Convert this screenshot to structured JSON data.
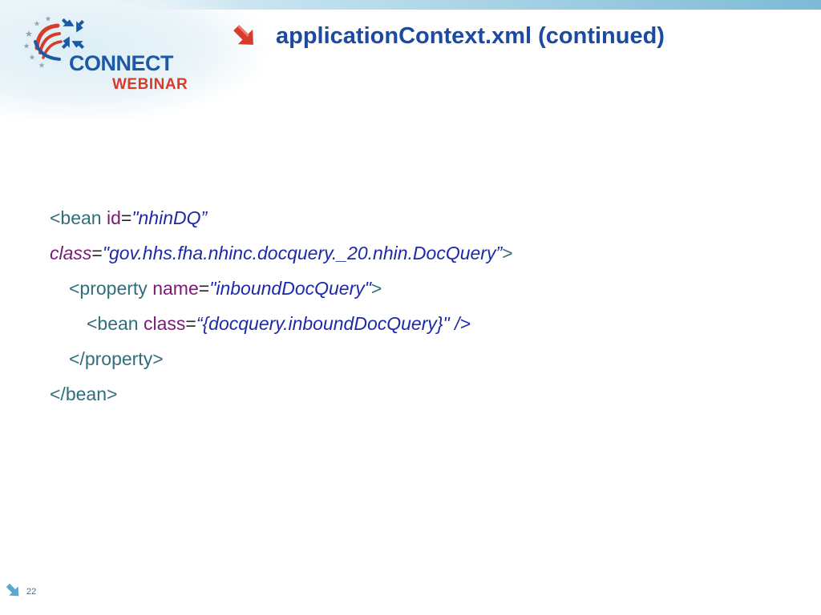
{
  "header": {
    "logo": {
      "connect": "CONNECT",
      "webinar": "WEBINAR"
    },
    "title": "applicationContext.xml (continued)"
  },
  "code": {
    "line1": {
      "open": "<bean ",
      "attr": "id",
      "eq": "=",
      "value": "\"nhinDQ”"
    },
    "line2": {
      "attr": "class",
      "eq": "=",
      "value": "\"gov.hhs.fha.nhinc.docquery._20.nhin.DocQuery”",
      "close": ">"
    },
    "line3": {
      "open": "<property ",
      "attr": "name",
      "eq": "=",
      "value": "\"inboundDocQuery\"",
      "close": ">"
    },
    "line4": {
      "open": "<bean ",
      "attr": "class",
      "eq": "=",
      "value": "“{docquery.inboundDocQuery}\"",
      "close": " />"
    },
    "line5": {
      "text": "</property>"
    },
    "line6": {
      "text": "</bean>"
    }
  },
  "footer": {
    "page_number": "22"
  },
  "colors": {
    "title": "#1b4aa0",
    "tag": "#2f6f7d",
    "attribute": "#7a1a78",
    "value": "#1d2aa8",
    "accent_red": "#d63c2c"
  }
}
